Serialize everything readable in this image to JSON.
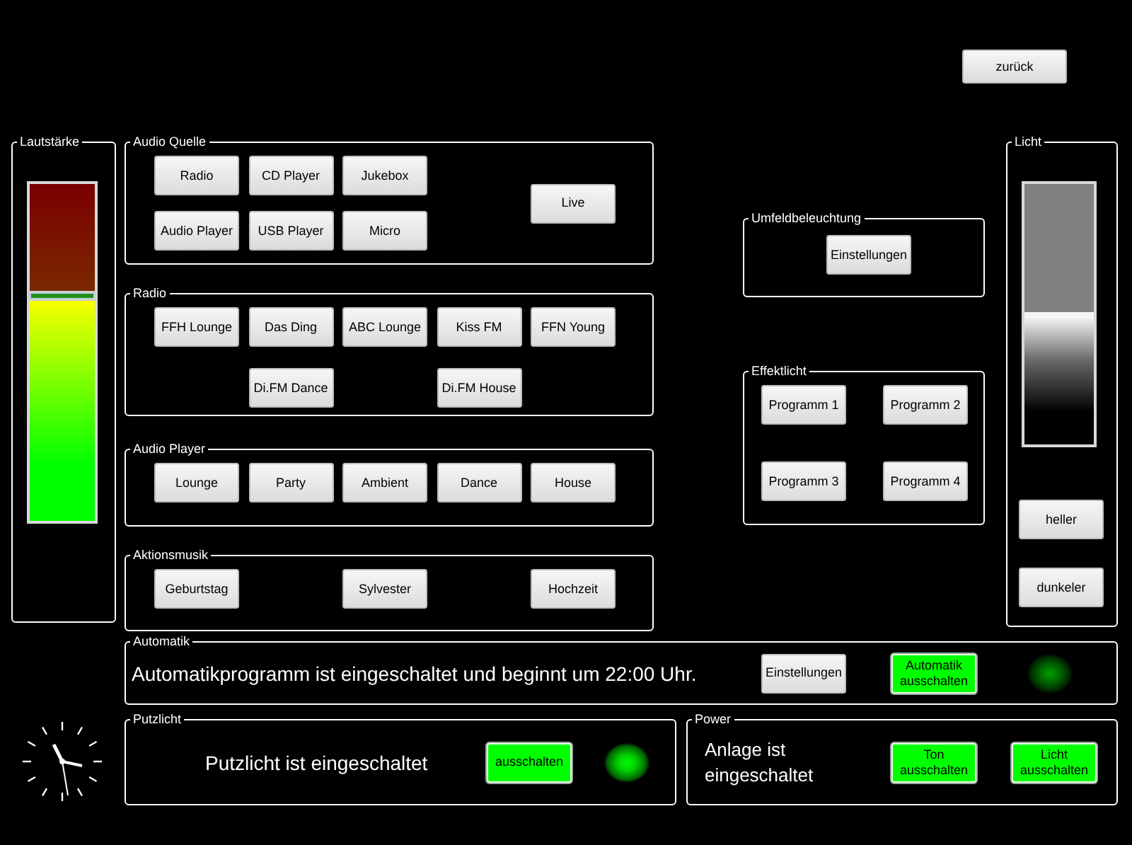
{
  "back_button": "zurück",
  "volume": {
    "title": "Lautstärke",
    "level": 0.67
  },
  "groups": [
    {
      "title": "Audio Quelle",
      "buttons": [
        "Radio",
        "CD Player",
        "Jukebox",
        "Audio Player",
        "USB Player",
        "Micro",
        "Live"
      ]
    },
    {
      "title": "Radio",
      "buttons": [
        "FFH Lounge",
        "Das Ding",
        "ABC Lounge",
        "Kiss FM",
        "FFN Young",
        "Di.FM Dance",
        "Di.FM House"
      ]
    },
    {
      "title": "Audio Player",
      "buttons": [
        "Lounge",
        "Party",
        "Ambient",
        "Dance",
        "House"
      ]
    },
    {
      "title": "Aktionsmusik",
      "buttons": [
        "Geburtstag",
        "Sylvester",
        "Hochzeit"
      ]
    }
  ],
  "ambient": {
    "title": "Umfeldbeleuchtung",
    "button": "Einstellungen"
  },
  "effects": {
    "title": "Effektlicht",
    "buttons": [
      "Programm 1",
      "Programm 2",
      "Programm 3",
      "Programm 4"
    ]
  },
  "light": {
    "title": "Licht",
    "level": 0.5,
    "buttons": [
      "heller",
      "dunkeler"
    ]
  },
  "automatik": {
    "title": "Automatik",
    "message": "Automatikprogramm ist eingeschaltet und beginnt um 22:00 Uhr.",
    "buttons": [
      {
        "label": "Einstellungen",
        "active": false
      },
      {
        "label": "Automatik ausschalten",
        "active": true
      }
    ],
    "lamp_on": false
  },
  "putzlicht": {
    "title": "Putzlicht",
    "message": "Putzlicht ist eingeschaltet",
    "buttons": [
      {
        "label": "ausschalten",
        "active": true
      }
    ],
    "lamp_on": true
  },
  "power": {
    "title": "Power",
    "message": "Anlage ist eingeschaltet",
    "buttons": [
      {
        "label": "Ton ausschalten",
        "active": true
      },
      {
        "label": "Licht ausschalten",
        "active": true
      }
    ]
  }
}
